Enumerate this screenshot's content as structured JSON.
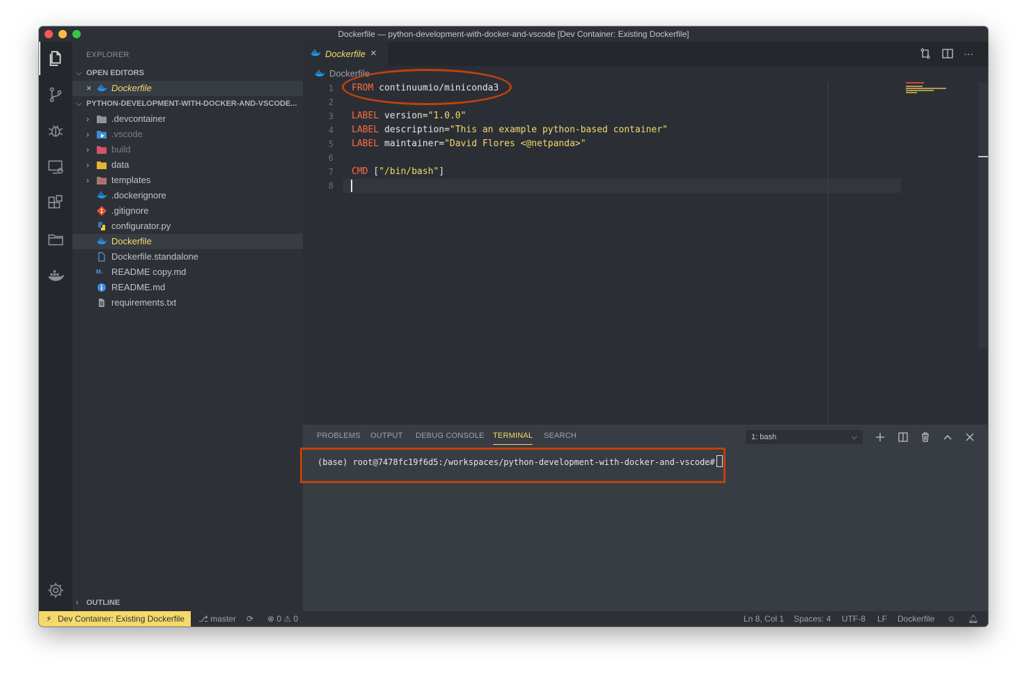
{
  "window": {
    "title": "Dockerfile — python-development-with-docker-and-vscode [Dev Container: Existing Dockerfile]"
  },
  "colors": {
    "accent_yellow": "#f5d96b",
    "annotation": "#c2410c",
    "keyword": "#ff6a3d",
    "window_bg": "#2b2f35",
    "sidebar_bg": "#2d3137",
    "panel_bg": "#383c43"
  },
  "activity_bar": {
    "items": [
      "files-icon",
      "source-control-icon",
      "debug-icon",
      "remote-explorer-icon",
      "extensions-icon",
      "folder-icon",
      "docker-icon"
    ],
    "bottom": "gear-icon"
  },
  "sidebar": {
    "title": "EXPLORER",
    "open_editors": {
      "header": "OPEN EDITORS",
      "items": [
        {
          "label": "Dockerfile",
          "icon": "docker-icon"
        }
      ]
    },
    "workspace": {
      "header": "PYTHON-DEVELOPMENT-WITH-DOCKER-AND-VSCODE...",
      "items": [
        {
          "label": ".devcontainer",
          "icon": "folder-icon",
          "folder": true
        },
        {
          "label": ".vscode",
          "icon": "vscode-folder-icon",
          "folder": true
        },
        {
          "label": "build",
          "icon": "build-folder-icon",
          "folder": true
        },
        {
          "label": "data",
          "icon": "data-folder-icon",
          "folder": true
        },
        {
          "label": "templates",
          "icon": "templates-folder-icon",
          "folder": true
        },
        {
          "label": ".dockerignore",
          "icon": "docker-icon"
        },
        {
          "label": ".gitignore",
          "icon": "git-icon"
        },
        {
          "label": "configurator.py",
          "icon": "python-icon"
        },
        {
          "label": "Dockerfile",
          "icon": "docker-icon"
        },
        {
          "label": "Dockerfile.standalone",
          "icon": "file-icon"
        },
        {
          "label": "README copy.md",
          "icon": "markdown-icon"
        },
        {
          "label": "README.md",
          "icon": "info-icon"
        },
        {
          "label": "requirements.txt",
          "icon": "text-file-icon"
        }
      ]
    },
    "outline": {
      "header": "OUTLINE"
    }
  },
  "editor": {
    "tab": {
      "label": "Dockerfile",
      "close": "×"
    },
    "actions": [
      "compare-changes-icon",
      "split-editor-icon",
      "more-actions-icon"
    ],
    "more_actions": "···",
    "breadcrumb": "Dockerfile",
    "lines": [
      {
        "num": "1",
        "kw": "FROM",
        "rest": " continuumio/miniconda3",
        "str": ""
      },
      {
        "num": "2",
        "kw": "",
        "rest": "",
        "str": ""
      },
      {
        "num": "3",
        "kw": "LABEL",
        "rest": " version=",
        "str": "\"1.0.0\""
      },
      {
        "num": "4",
        "kw": "LABEL",
        "rest": " description=",
        "str": "\"This an example python-based container\""
      },
      {
        "num": "5",
        "kw": "LABEL",
        "rest": " maintainer=",
        "str": "\"David Flores <@netpanda>\""
      },
      {
        "num": "6",
        "kw": "",
        "rest": "",
        "str": ""
      },
      {
        "num": "7",
        "kw": "CMD",
        "rest": " [",
        "str": "\"/bin/bash\"",
        "tail": "]"
      },
      {
        "num": "8",
        "kw": "",
        "rest": "",
        "str": ""
      }
    ]
  },
  "panel": {
    "tabs": [
      "PROBLEMS",
      "OUTPUT",
      "DEBUG CONSOLE",
      "TERMINAL",
      "SEARCH"
    ],
    "active_tab": "TERMINAL",
    "terminal_selector": "1: bash",
    "terminal_line": "(base) root@7478fc19f6d5:/workspaces/python-development-with-docker-and-vscode#"
  },
  "statusbar": {
    "remote": "Dev Container: Existing Dockerfile",
    "branch": "master",
    "errors": "0",
    "warnings": "0",
    "position": "Ln 8, Col 1",
    "spaces": "Spaces: 4",
    "encoding": "UTF-8",
    "eol": "LF",
    "language": "Dockerfile"
  }
}
